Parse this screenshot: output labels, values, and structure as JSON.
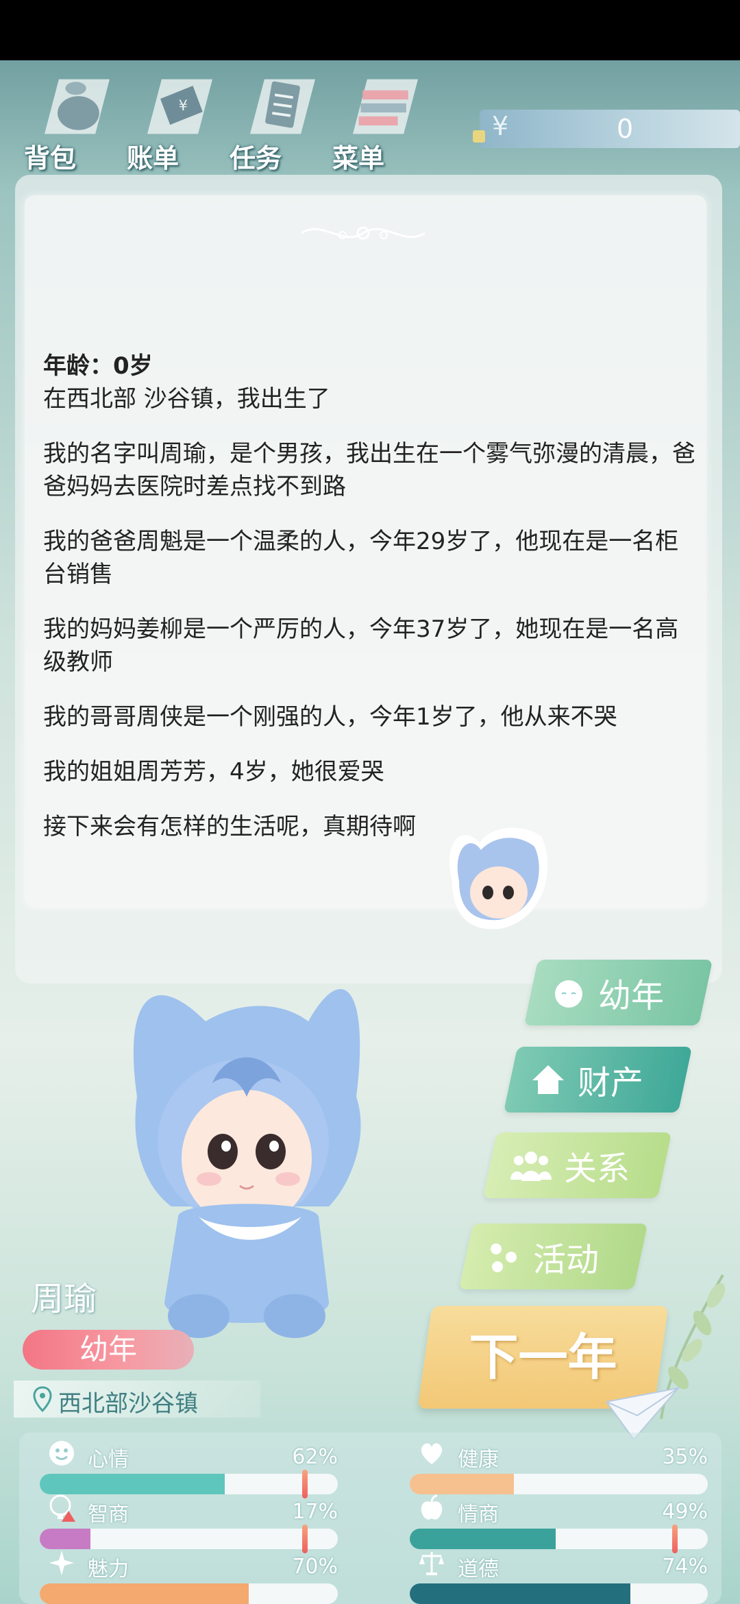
{
  "toolbar": {
    "items": [
      {
        "label": "背包",
        "icon": "bag-icon"
      },
      {
        "label": "账单",
        "icon": "bill-icon"
      },
      {
        "label": "任务",
        "icon": "task-icon"
      },
      {
        "label": "菜单",
        "icon": "menu-icon"
      }
    ],
    "money": {
      "symbol": "¥",
      "value": "0"
    }
  },
  "story": {
    "age_line": "年龄：0岁",
    "paragraphs": [
      "在西北部 沙谷镇，我出生了",
      "我的名字叫周瑜，是个男孩，我出生在一个雾气弥漫的清晨，爸爸妈妈去医院时差点找不到路",
      "我的爸爸周魁是一个温柔的人，今年29岁了，他现在是一名柜台销售",
      "我的妈妈姜柳是一个严厉的人，今年37岁了，她现在是一名高级教师",
      "我的哥哥周侠是一个刚强的人，今年1岁了，他从来不哭",
      "我的姐姐周芳芳，4岁，她很爱哭",
      "接下来会有怎样的生活呢，真期待啊"
    ]
  },
  "menu": {
    "stage_button": "幼年",
    "assets_button": "财产",
    "relations_button": "关系",
    "activity_button": "活动",
    "next_year_button": "下一年"
  },
  "character": {
    "name": "周瑜",
    "stage": "幼年",
    "location": "西北部沙谷镇"
  },
  "stats": [
    {
      "label": "心情",
      "percent": "62%",
      "value": 0.62,
      "color": "#5fc6bd",
      "icon": "smile-icon",
      "marker": 0.89
    },
    {
      "label": "健康",
      "percent": "35%",
      "value": 0.35,
      "color": "#f6c08f",
      "icon": "heart-icon",
      "marker": null
    },
    {
      "label": "智商",
      "percent": "17%",
      "value": 0.17,
      "color": "#c77bc4",
      "icon": "brain-icon",
      "marker": 0.89
    },
    {
      "label": "情商",
      "percent": "49%",
      "value": 0.49,
      "color": "#3aa29a",
      "icon": "apple-icon",
      "marker": 0.89
    },
    {
      "label": "魅力",
      "percent": "70%",
      "value": 0.7,
      "color": "#f4a96f",
      "icon": "sparkle-icon",
      "marker": null
    },
    {
      "label": "道德",
      "percent": "74%",
      "value": 0.74,
      "color": "#246f7e",
      "icon": "scale-icon",
      "marker": null
    }
  ],
  "colors": {
    "accent": "#f3c876",
    "stage_pink": "#f37685",
    "teal": "#3fa898"
  }
}
